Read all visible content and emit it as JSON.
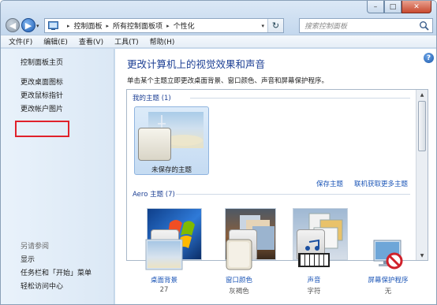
{
  "window": {
    "controls": {
      "minimize": "–",
      "maximize": "□",
      "close": "✕"
    }
  },
  "nav": {
    "back": "◀",
    "forward": "▶",
    "history": "▾"
  },
  "address": {
    "breadcrumbs": [
      "控制面板",
      "所有控制面板项",
      "个性化"
    ],
    "separator": "▸",
    "dropdown": "▾",
    "refresh": "↻"
  },
  "search": {
    "placeholder": "搜索控制面板"
  },
  "menu": [
    "文件(F)",
    "编辑(E)",
    "查看(V)",
    "工具(T)",
    "帮助(H)"
  ],
  "sidebar": {
    "links": [
      "控制面板主页",
      "更改桌面图标",
      "更改鼠标指针",
      "更改帐户图片"
    ],
    "highlighted_index": 1,
    "see_also_label": "另请参阅",
    "see_also": [
      "显示",
      "任务栏和「开始」菜单",
      "轻松访问中心"
    ]
  },
  "main": {
    "help": "?",
    "title": "更改计算机上的视觉效果和声音",
    "description": "单击某个主题立即更改桌面背景、窗口颜色、声音和屏幕保护程序。",
    "my_themes_label": "我的主题 (1)",
    "unsaved_theme": "未保存的主题",
    "save_theme": "保存主题",
    "more_themes": "联机获取更多主题",
    "aero_label": "Aero 主题 (7)",
    "scroll": {
      "up": "▲",
      "down": "▼"
    }
  },
  "settings": [
    {
      "label": "桌面背景",
      "value": "27",
      "icon": "desktop-background-icon"
    },
    {
      "label": "窗口颜色",
      "value": "灰褐色",
      "icon": "window-color-icon"
    },
    {
      "label": "声音",
      "value": "字符",
      "icon": "sound-icon"
    },
    {
      "label": "屏幕保护程序",
      "value": "无",
      "icon": "screensaver-icon"
    }
  ],
  "colors": {
    "link": "#1c56b7",
    "title": "#1c3f94",
    "highlight_box": "#e0212b"
  }
}
